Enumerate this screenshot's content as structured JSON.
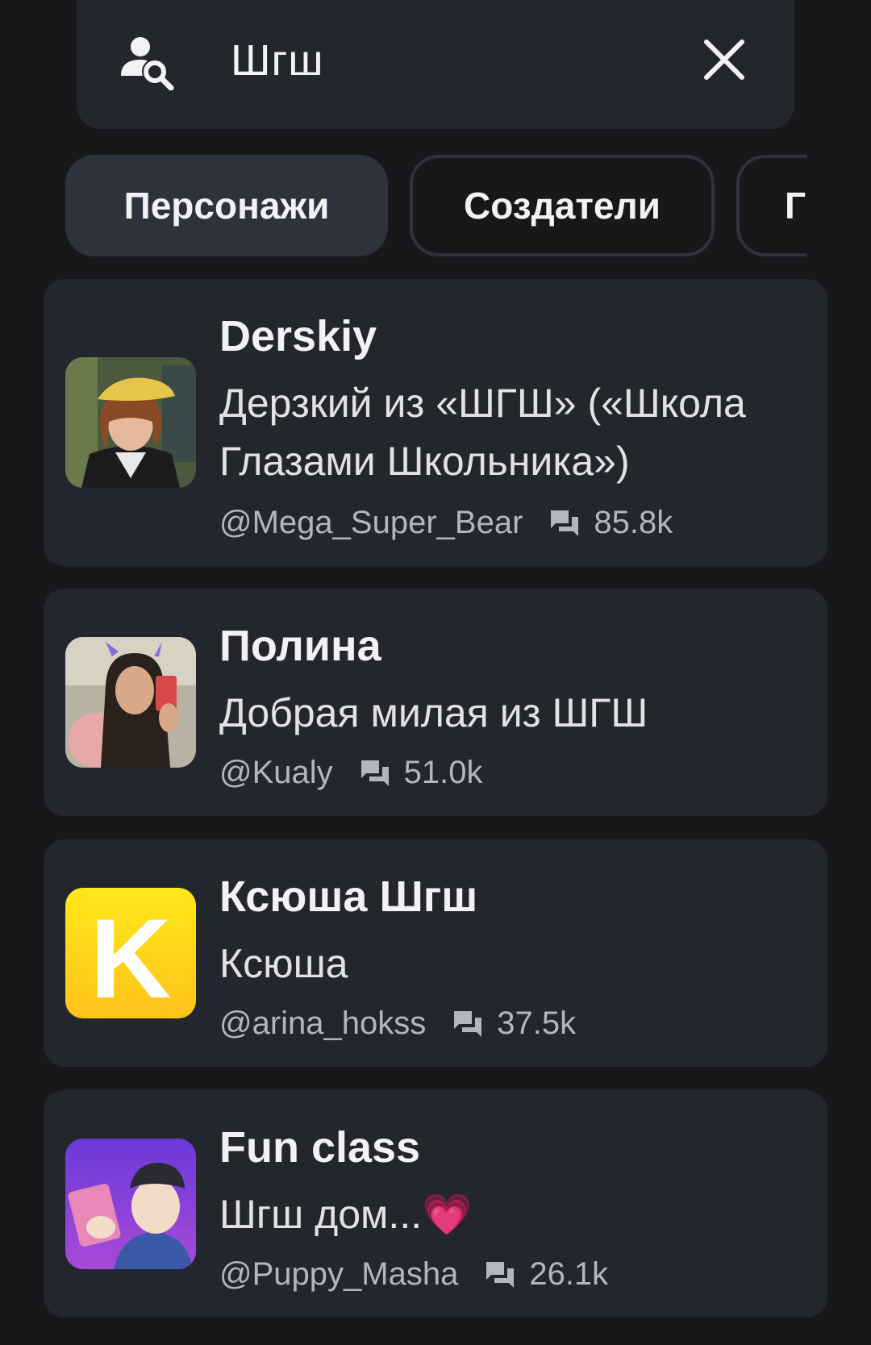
{
  "search": {
    "query": "Шгш"
  },
  "tabs": [
    {
      "label": "Персонажи"
    },
    {
      "label": "Создатели"
    },
    {
      "label": "Г"
    }
  ],
  "results": [
    {
      "name": "Derskiy",
      "description": "Дерзкий из «ШГШ» («Школа Глазами Школьника»)",
      "author": "@Mega_Super_Bear",
      "chats": "85.8k"
    },
    {
      "name": "Полина",
      "description": "Добрая милая из ШГШ",
      "author": "@Kualy",
      "chats": "51.0k"
    },
    {
      "name": "Ксюша Шгш",
      "description": "Ксюша",
      "author": "@arina_hokss",
      "chats": "37.5k",
      "avatar_letter": "K"
    },
    {
      "name": "Fun class",
      "description": "Шгш дом...💗",
      "author": "@Puppy_Masha",
      "chats": "26.1k"
    }
  ],
  "colors": {
    "background": "#18181b",
    "card": "#24262e",
    "chip_active": "#2e323d",
    "muted_text": "#b4b6bf"
  }
}
